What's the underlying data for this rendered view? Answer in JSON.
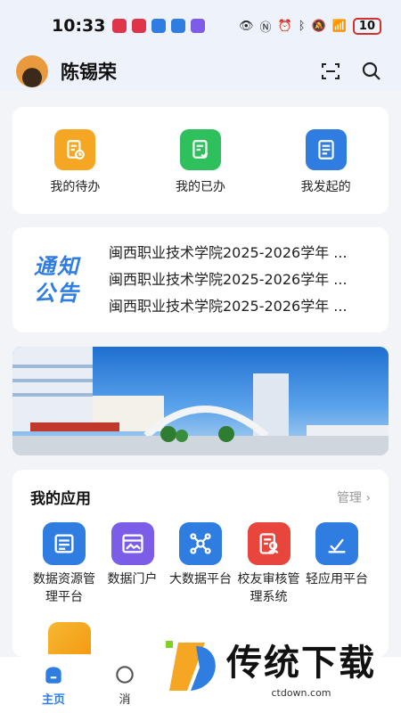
{
  "status": {
    "time": "10:33",
    "battery": "10"
  },
  "header": {
    "username": "陈锡荣"
  },
  "quick": [
    {
      "label": "我的待办",
      "icon": "todo-icon",
      "color": "#f5a623"
    },
    {
      "label": "我的已办",
      "icon": "done-icon",
      "color": "#2ec05c"
    },
    {
      "label": "我发起的",
      "icon": "initiated-icon",
      "color": "#2f7de1"
    }
  ],
  "notice": {
    "badge_line1": "通知",
    "badge_line2": "公告",
    "items": [
      "闽西职业技术学院2025-2026学年 ...",
      "闽西职业技术学院2025-2026学年 ...",
      "闽西职业技术学院2025-2026学年 ..."
    ]
  },
  "apps": {
    "title": "我的应用",
    "manage": "管理 ›",
    "items": [
      {
        "label": "数据资源管理平台",
        "icon": "database-icon",
        "color": "#2f7de1"
      },
      {
        "label": "数据门户",
        "icon": "portal-icon",
        "color": "#7b5de8"
      },
      {
        "label": "大数据平台",
        "icon": "network-icon",
        "color": "#2f7de1"
      },
      {
        "label": "校友审核管理系统",
        "icon": "alumni-icon",
        "color": "#e8453c"
      },
      {
        "label": "轻应用平台",
        "icon": "light-app-icon",
        "color": "#2f7de1"
      }
    ]
  },
  "tabbar": {
    "home": "主页",
    "message": "消"
  },
  "watermark": {
    "text": "传统下载",
    "url": "ctdown.com"
  }
}
